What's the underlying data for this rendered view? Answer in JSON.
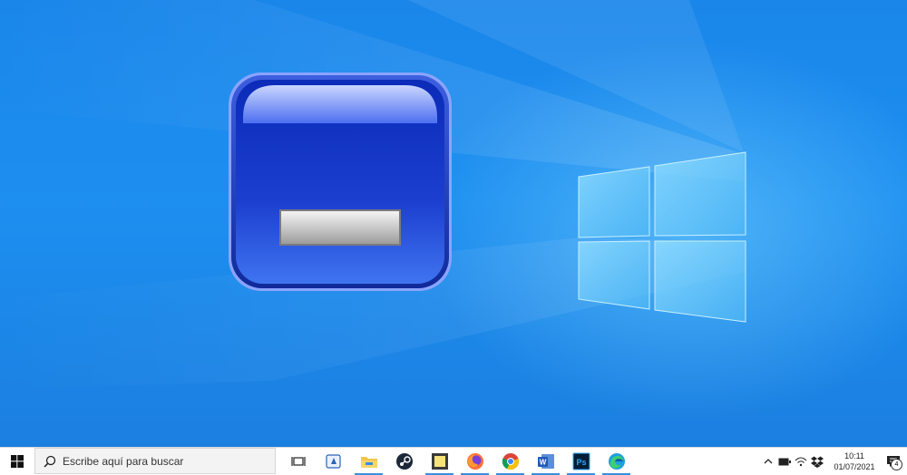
{
  "taskbar": {
    "search_placeholder": "Escribe aquí para buscar",
    "apps": [
      {
        "icon": "task-view-icon"
      },
      {
        "icon": "compass-app-icon"
      },
      {
        "icon": "file-explorer-icon"
      },
      {
        "icon": "steam-icon"
      },
      {
        "icon": "sticky-notes-icon"
      },
      {
        "icon": "firefox-icon"
      },
      {
        "icon": "chrome-icon"
      },
      {
        "icon": "word-icon",
        "label": "W"
      },
      {
        "icon": "photoshop-icon",
        "label": "Ps"
      },
      {
        "icon": "edge-icon"
      }
    ],
    "tray": {
      "time": "10:11",
      "date": "01/07/2021",
      "notification_count": "4"
    }
  },
  "colors": {
    "desktop": "#1d8ff0",
    "icon_blue": "#1c3fc9",
    "taskbar": "#ffffff"
  }
}
